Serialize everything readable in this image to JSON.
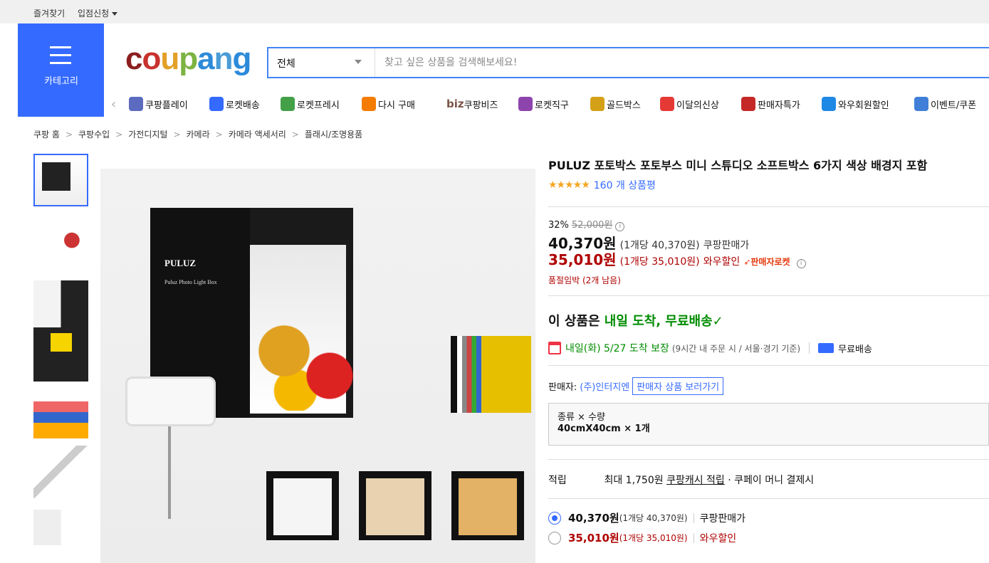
{
  "topbar": {
    "favorites": "즐겨찾기",
    "seller_apply": "입점신청"
  },
  "category": {
    "label": "카테고리"
  },
  "logo": {
    "letters": [
      "c",
      "o",
      "u",
      "p",
      "a",
      "n",
      "g"
    ],
    "colors": [
      "#8b1e1e",
      "#c8322d",
      "#e3a027",
      "#7cb342",
      "#2c8ad9",
      "#4a9cd6",
      "#2c8ad9"
    ]
  },
  "search": {
    "scope": "전체",
    "placeholder": "찾고 싶은 상품을 검색해보세요!"
  },
  "nav": {
    "items": [
      {
        "label": "쿠팡플레이",
        "icon": "play-icon",
        "color": "#5c6bc0"
      },
      {
        "label": "로켓배송",
        "icon": "rocket-icon",
        "color": "#346aff"
      },
      {
        "label": "로켓프레시",
        "icon": "rocket-fresh-icon",
        "color": "#43a047"
      },
      {
        "label": "다시 구매",
        "icon": "rebuy-icon",
        "color": "#f57c00"
      },
      {
        "label": "쿠팡비즈",
        "icon": "biz-icon",
        "color": "#795548",
        "prefix": "biz"
      },
      {
        "label": "로켓직구",
        "icon": "rocket-direct-icon",
        "color": "#8e44ad"
      },
      {
        "label": "골드박스",
        "icon": "goldbox-icon",
        "color": "#d4a017"
      },
      {
        "label": "이달의신상",
        "icon": "new-icon",
        "color": "#e53935"
      },
      {
        "label": "판매자특가",
        "icon": "percent-icon",
        "color": "#c62828"
      },
      {
        "label": "와우회원할인",
        "icon": "wow-icon",
        "color": "#1e88e5"
      },
      {
        "label": "이벤트/쿠폰",
        "icon": "coupon-icon",
        "color": "#3f7fd8"
      }
    ]
  },
  "breadcrumb": [
    "쿠팡 홈",
    "쿠팡수입",
    "가전디지털",
    "카메라",
    "카메라 액세서리",
    "플래시/조명용품"
  ],
  "product": {
    "title": "PULUZ 포토박스 포토부스 미니 스튜디오 소프트박스 6가지 색상 배경지 포함",
    "rating": 4.5,
    "review_count": "160 개 상품평",
    "discount_rate": "32%",
    "original_price": "52,000원",
    "price_coupang": "40,370원",
    "price_coupang_unit": "(1개당 40,370원)",
    "price_coupang_label": "쿠팡판매가",
    "price_wow": "35,010원",
    "price_wow_unit": "(1개당 35,010원)",
    "price_wow_label": "와우할인",
    "rocket_badge": "판매자로켓",
    "stock_notice": "품절임박 (2개 남음)",
    "delivery_headline_prefix": "이 상품은 ",
    "delivery_headline": "내일 도착, 무료배송",
    "delivery_date": "내일(화) 5/27 도착 보장",
    "delivery_note": "(9시간 내 주문 시 / 서울·경기 기준)",
    "free_shipping": "무료배송",
    "seller_label": "판매자:",
    "seller_name": "(주)인터지엔",
    "seller_button": "판매자 상품 보러가기",
    "option_label": "종류 × 수량",
    "option_value": "40cmX40cm × 1개",
    "reward_label": "적립",
    "reward_text": "최대 1,750원",
    "reward_link": "쿠팡캐시 적립",
    "reward_suffix": "· 쿠페이 머니 결제시"
  },
  "price_options": [
    {
      "price": "40,370원",
      "unit": "(1개당 40,370원)",
      "label": "쿠팡판매가",
      "selected": true
    },
    {
      "price": "35,010원",
      "unit": "(1개당 35,010원)",
      "label": "와우할인",
      "selected": false
    }
  ],
  "image": {
    "brand_mark": "PULUZ",
    "brand_sub": "Puluz Photo Light Box"
  }
}
